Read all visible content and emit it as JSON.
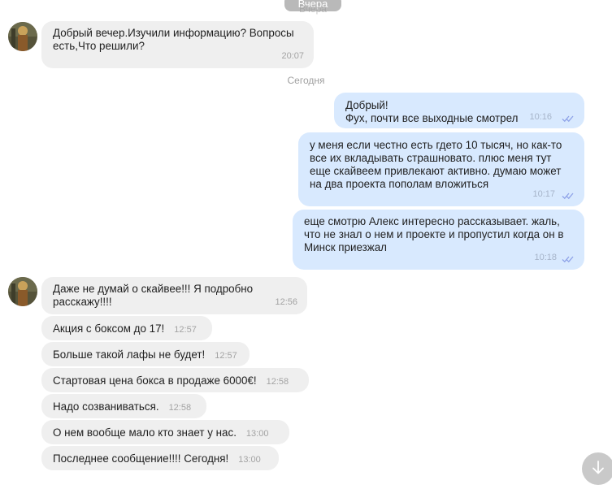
{
  "date_chip": "Вчера",
  "date_separator": "Сегодня",
  "messages": {
    "m1": {
      "lines": [
        "Добрый вечер.Изучили информацию? Вопросы",
        "есть,Что решили?"
      ],
      "time": "20:07"
    },
    "m2": {
      "lines": [
        "Добрый!",
        "Фух, почти все выходные смотрел"
      ],
      "time": "10:16"
    },
    "m3": {
      "lines": [
        "у меня если честно есть гдето 10 тысяч, но как-то",
        "все их вкладывать страшновато. плюс меня тут",
        "еще скайвеем привлекают активно. думаю может",
        "на два проекта пополам вложиться"
      ],
      "time": "10:17"
    },
    "m4": {
      "lines": [
        "еще смотрю Алекс интересно рассказывает. жаль,",
        "что не знал о нем и проекте и пропустил когда он в",
        "Минск приезжал"
      ],
      "time": "10:18"
    },
    "m5": {
      "lines": [
        "Даже не думай о скайвее!!! Я подробно",
        "расскажу!!!!"
      ],
      "time": "12:56"
    },
    "m6": {
      "text": "Акция с боксом до 17!",
      "time": "12:57"
    },
    "m7": {
      "text": "Больше такой лафы не будет!",
      "time": "12:57"
    },
    "m8": {
      "text": "Стартовая цена бокса в продаже 6000€!",
      "time": "12:58"
    },
    "m9": {
      "text": "Надо созваниваться.",
      "time": "12:58"
    },
    "m10": {
      "text": "О нем вообще мало кто знает у  нас.",
      "time": "13:00"
    },
    "m11": {
      "text": "Последнее сообщение!!!! Сегодня!",
      "time": "13:00"
    }
  },
  "icons": {
    "read_status": "double-check-icon",
    "scroll_down": "arrow-down-icon",
    "avatar": "avatar"
  },
  "colors": {
    "incoming_bubble": "#efefef",
    "outgoing_bubble": "#d8e9fe",
    "read_ticks": "#8ea2e8"
  }
}
